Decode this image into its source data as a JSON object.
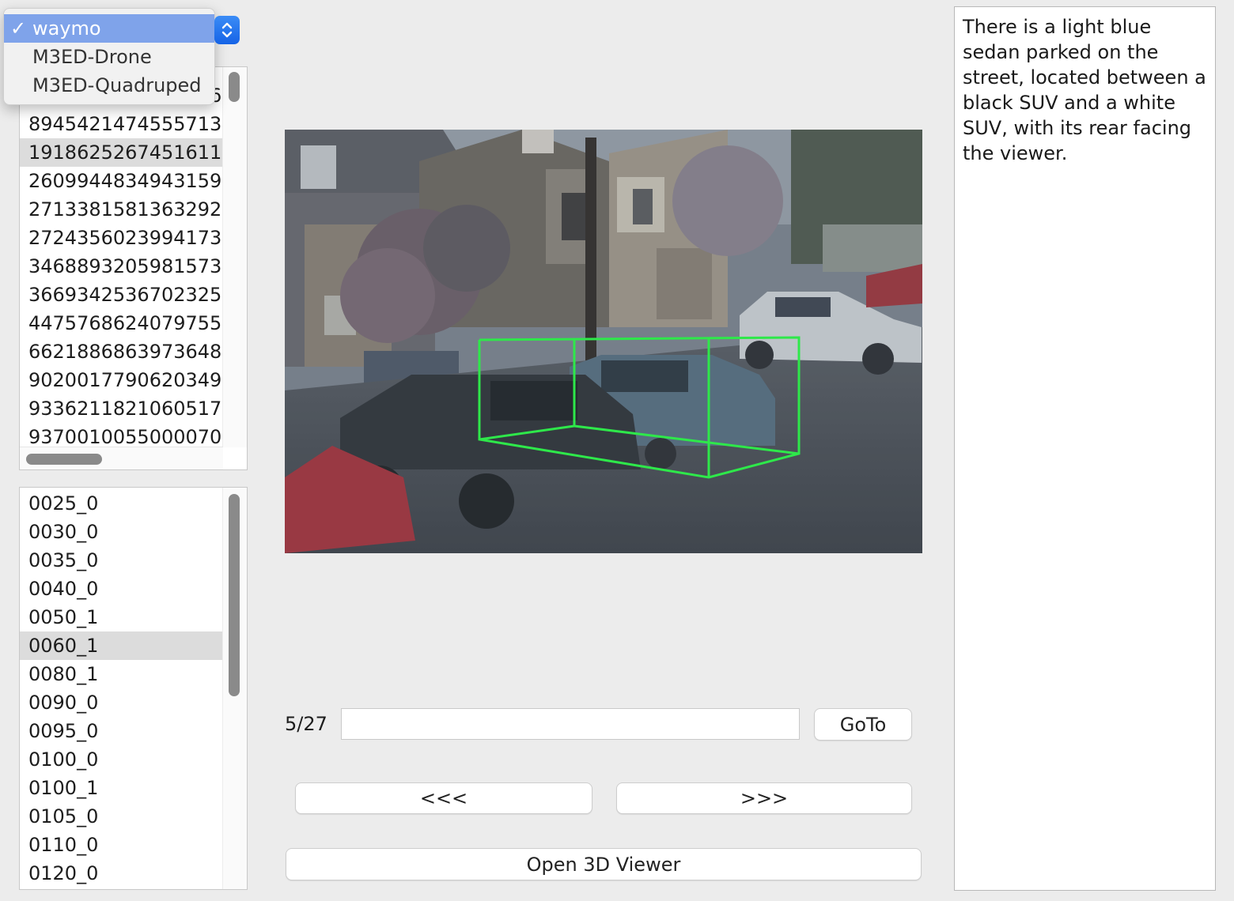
{
  "dataset_selector": {
    "options": [
      {
        "label": "waymo",
        "selected": true
      },
      {
        "label": "M3ED-Drone",
        "selected": false
      },
      {
        "label": "M3ED-Quadruped",
        "selected": false
      }
    ]
  },
  "sequence_list": {
    "partial_top": "0",
    "items": [
      {
        "label": "3077939657605416",
        "selected": false
      },
      {
        "label": "8945421474555713",
        "selected": false
      },
      {
        "label": "1918625267451611",
        "selected": true
      },
      {
        "label": "2609944834943159",
        "selected": false
      },
      {
        "label": "2713381581363292",
        "selected": false
      },
      {
        "label": "2724356023994173",
        "selected": false
      },
      {
        "label": "3468893205981573",
        "selected": false
      },
      {
        "label": "3669342536702325",
        "selected": false
      },
      {
        "label": "4475768624079755",
        "selected": false
      },
      {
        "label": "6621886863973648",
        "selected": false
      },
      {
        "label": "9020017790620349",
        "selected": false
      },
      {
        "label": "9336211821060517",
        "selected": false
      },
      {
        "label": "9370010055000070",
        "selected": false
      }
    ]
  },
  "frame_list": {
    "items": [
      {
        "label": "0025_0",
        "selected": false
      },
      {
        "label": "0030_0",
        "selected": false
      },
      {
        "label": "0035_0",
        "selected": false
      },
      {
        "label": "0040_0",
        "selected": false
      },
      {
        "label": "0050_1",
        "selected": false
      },
      {
        "label": "0060_1",
        "selected": true
      },
      {
        "label": "0080_1",
        "selected": false
      },
      {
        "label": "0090_0",
        "selected": false
      },
      {
        "label": "0095_0",
        "selected": false
      },
      {
        "label": "0100_0",
        "selected": false
      },
      {
        "label": "0100_1",
        "selected": false
      },
      {
        "label": "0105_0",
        "selected": false
      },
      {
        "label": "0110_0",
        "selected": false
      },
      {
        "label": "0120_0",
        "selected": false
      }
    ]
  },
  "viewer": {
    "box_color": "#2ee84a"
  },
  "navigation": {
    "counter": "5/27",
    "goto_value": "",
    "goto_label": "GoTo",
    "prev_label": "<<<",
    "next_label": ">>>",
    "open_3d_label": "Open 3D Viewer"
  },
  "description": {
    "text": "There is a light blue sedan parked on the street, located between a black SUV and a white SUV, with its rear facing the viewer."
  }
}
